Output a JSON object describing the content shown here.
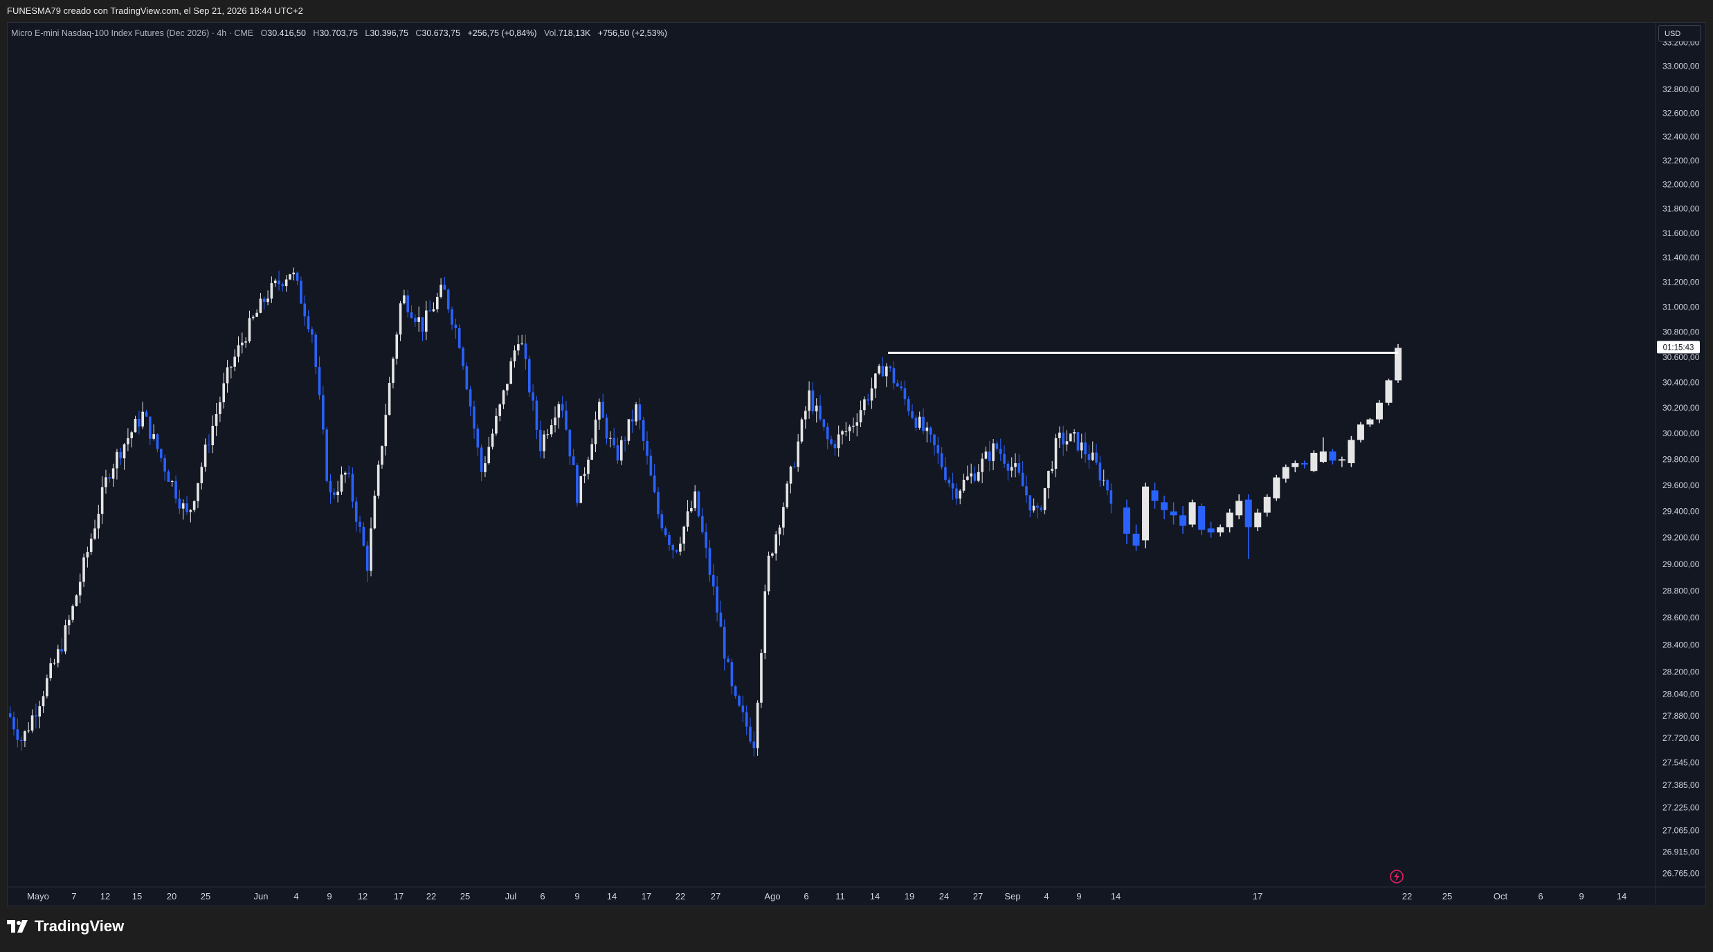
{
  "header": {
    "caption": "FUNESMA79 creado con TradingView.com, el Sep 21, 2026 18:44 UTC+2"
  },
  "legend": {
    "symbol": "Micro E-mini Nasdaq-100 Index Futures (Dec 2026) · 4h · CME",
    "open_label": "O",
    "open": "30.416,50",
    "high_label": "H",
    "high": "30.703,75",
    "low_label": "L",
    "low": "30.396,75",
    "close_label": "C",
    "close": "30.673,75",
    "change": "+256,75 (+0,84%)",
    "volume_label": "Vol.",
    "volume": "718,13K",
    "extra": "+756,50 (+2,53%)"
  },
  "currency": "USD",
  "countdown": "01:15:43",
  "brand": "TradingView",
  "colors": {
    "background": "#131722",
    "up_candle": "#e6e6e6",
    "down_candle": "#2962ff",
    "horizontal_line": "#ffffff",
    "axis_text": "#d1d4dc"
  },
  "chart_data": {
    "type": "candlestick",
    "interval": "4h",
    "x_tick_labels": [
      "Mayo",
      "7",
      "12",
      "15",
      "20",
      "25",
      "Jun",
      "4",
      "9",
      "12",
      "17",
      "22",
      "25",
      "Jul",
      "6",
      "9",
      "14",
      "17",
      "22",
      "27",
      "Ago",
      "6",
      "11",
      "14",
      "19",
      "24",
      "27",
      "Sep",
      "4",
      "9",
      "14",
      "17",
      "22",
      "25",
      "Oct",
      "6",
      "9",
      "14"
    ],
    "y_tick_labels": [
      "33.200,00",
      "33.000,00",
      "32.800,00",
      "32.600,00",
      "32.400,00",
      "32.200,00",
      "32.000,00",
      "31.800,00",
      "31.600,00",
      "31.400,00",
      "31.200,00",
      "31.000,00",
      "30.800,00",
      "30.600,00",
      "30.400,00",
      "30.200,00",
      "30.000,00",
      "29.800,00",
      "29.600,00",
      "29.400,00",
      "29.200,00",
      "29.000,00",
      "28.800,00",
      "28.600,00",
      "28.400,00",
      "28.200,00",
      "28.040,00",
      "27.880,00",
      "27.720,00",
      "27.545,00",
      "27.385,00",
      "27.225,00",
      "27.065,00",
      "26.915,00",
      "26.765,00"
    ],
    "y_scale": "log",
    "y_range": [
      26700,
      33300
    ],
    "horizontal_level": 30635,
    "last_price": 30673.75,
    "segment_a": {
      "x_from": "Mayo",
      "x_to": "14",
      "path": [
        [
          0,
          27900
        ],
        [
          20,
          27700
        ],
        [
          45,
          28000
        ],
        [
          70,
          28300
        ],
        [
          90,
          28600
        ],
        [
          110,
          29000
        ],
        [
          125,
          29300
        ],
        [
          145,
          29700
        ],
        [
          165,
          29900
        ],
        [
          195,
          30150
        ],
        [
          230,
          29700
        ],
        [
          260,
          29350
        ],
        [
          290,
          29950
        ],
        [
          320,
          30500
        ],
        [
          345,
          30800
        ],
        [
          375,
          31100
        ],
        [
          410,
          31300
        ],
        [
          440,
          30800
        ],
        [
          465,
          29500
        ],
        [
          490,
          29700
        ],
        [
          520,
          29000
        ],
        [
          545,
          30100
        ],
        [
          570,
          31100
        ],
        [
          600,
          30850
        ],
        [
          630,
          31150
        ],
        [
          655,
          30700
        ],
        [
          685,
          29700
        ],
        [
          715,
          30250
        ],
        [
          740,
          30800
        ],
        [
          770,
          29900
        ],
        [
          800,
          30300
        ],
        [
          825,
          29500
        ],
        [
          855,
          30200
        ],
        [
          880,
          29800
        ],
        [
          910,
          30200
        ],
        [
          940,
          29400
        ],
        [
          965,
          29100
        ],
        [
          995,
          29500
        ],
        [
          1025,
          28700
        ],
        [
          1050,
          28000
        ],
        [
          1080,
          27700
        ],
        [
          1100,
          29000
        ],
        [
          1130,
          29600
        ],
        [
          1160,
          30300
        ],
        [
          1190,
          29900
        ],
        [
          1220,
          30050
        ],
        [
          1250,
          30350
        ],
        [
          1270,
          30550
        ],
        [
          1310,
          30150
        ],
        [
          1340,
          29900
        ],
        [
          1370,
          29550
        ],
        [
          1400,
          29700
        ],
        [
          1430,
          29900
        ],
        [
          1460,
          29700
        ],
        [
          1490,
          29350
        ],
        [
          1520,
          29950
        ],
        [
          1545,
          29950
        ],
        [
          1570,
          29800
        ],
        [
          1600,
          29500
        ]
      ]
    },
    "segment_b": {
      "candles": [
        {
          "o": 29430,
          "h": 29490,
          "l": 29150,
          "c": 29230
        },
        {
          "o": 29230,
          "h": 29300,
          "l": 29100,
          "c": 29140
        },
        {
          "o": 29180,
          "h": 29620,
          "l": 29120,
          "c": 29590
        },
        {
          "o": 29560,
          "h": 29620,
          "l": 29420,
          "c": 29480
        },
        {
          "o": 29470,
          "h": 29520,
          "l": 29340,
          "c": 29410
        },
        {
          "o": 29400,
          "h": 29470,
          "l": 29300,
          "c": 29370
        },
        {
          "o": 29370,
          "h": 29440,
          "l": 29230,
          "c": 29290
        },
        {
          "o": 29300,
          "h": 29490,
          "l": 29280,
          "c": 29470
        },
        {
          "o": 29440,
          "h": 29460,
          "l": 29220,
          "c": 29260
        },
        {
          "o": 29270,
          "h": 29320,
          "l": 29200,
          "c": 29240
        },
        {
          "o": 29240,
          "h": 29300,
          "l": 29210,
          "c": 29280
        },
        {
          "o": 29280,
          "h": 29420,
          "l": 29240,
          "c": 29390
        },
        {
          "o": 29370,
          "h": 29530,
          "l": 29340,
          "c": 29480
        },
        {
          "o": 29490,
          "h": 29530,
          "l": 29040,
          "c": 29280
        },
        {
          "o": 29280,
          "h": 29420,
          "l": 29250,
          "c": 29390
        },
        {
          "o": 29390,
          "h": 29530,
          "l": 29360,
          "c": 29510
        },
        {
          "o": 29500,
          "h": 29680,
          "l": 29480,
          "c": 29660
        },
        {
          "o": 29650,
          "h": 29760,
          "l": 29620,
          "c": 29740
        },
        {
          "o": 29740,
          "h": 29790,
          "l": 29700,
          "c": 29770
        },
        {
          "o": 29770,
          "h": 29790,
          "l": 29730,
          "c": 29760
        },
        {
          "o": 29710,
          "h": 29870,
          "l": 29700,
          "c": 29850
        },
        {
          "o": 29780,
          "h": 29970,
          "l": 29770,
          "c": 29860
        },
        {
          "o": 29860,
          "h": 29880,
          "l": 29760,
          "c": 29790
        },
        {
          "o": 29790,
          "h": 29820,
          "l": 29740,
          "c": 29800
        },
        {
          "o": 29770,
          "h": 29980,
          "l": 29740,
          "c": 29950
        },
        {
          "o": 29950,
          "h": 30090,
          "l": 29930,
          "c": 30070
        },
        {
          "o": 30070,
          "h": 30120,
          "l": 30050,
          "c": 30110
        },
        {
          "o": 30110,
          "h": 30260,
          "l": 30080,
          "c": 30240
        },
        {
          "o": 30240,
          "h": 30430,
          "l": 30220,
          "c": 30416.5
        },
        {
          "o": 30416.5,
          "h": 30703.75,
          "l": 30396.75,
          "c": 30673.75
        }
      ]
    }
  }
}
